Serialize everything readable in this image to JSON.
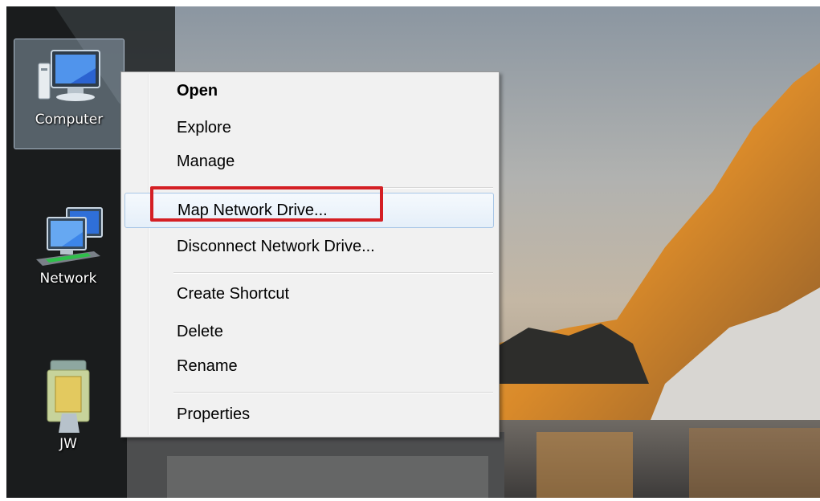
{
  "desktop": {
    "icons": [
      {
        "label": "Computer",
        "icon": "computer-icon",
        "selected": true
      },
      {
        "label": "Network",
        "icon": "network-icon",
        "selected": false
      },
      {
        "label": "JW",
        "icon": "user-folder-icon",
        "selected": false
      }
    ]
  },
  "context_menu": {
    "items": [
      {
        "label": "Open",
        "bold": true
      },
      {
        "label": "Explore"
      },
      {
        "label": "Manage"
      },
      {
        "label": "Map Network Drive...",
        "hovered": true,
        "highlighted": true
      },
      {
        "label": "Disconnect Network Drive..."
      },
      {
        "label": "Create Shortcut"
      },
      {
        "label": "Delete"
      },
      {
        "label": "Rename"
      },
      {
        "label": "Properties"
      }
    ],
    "highlight_color": "#d41f24",
    "hover_border_color": "#a8c6e6"
  }
}
